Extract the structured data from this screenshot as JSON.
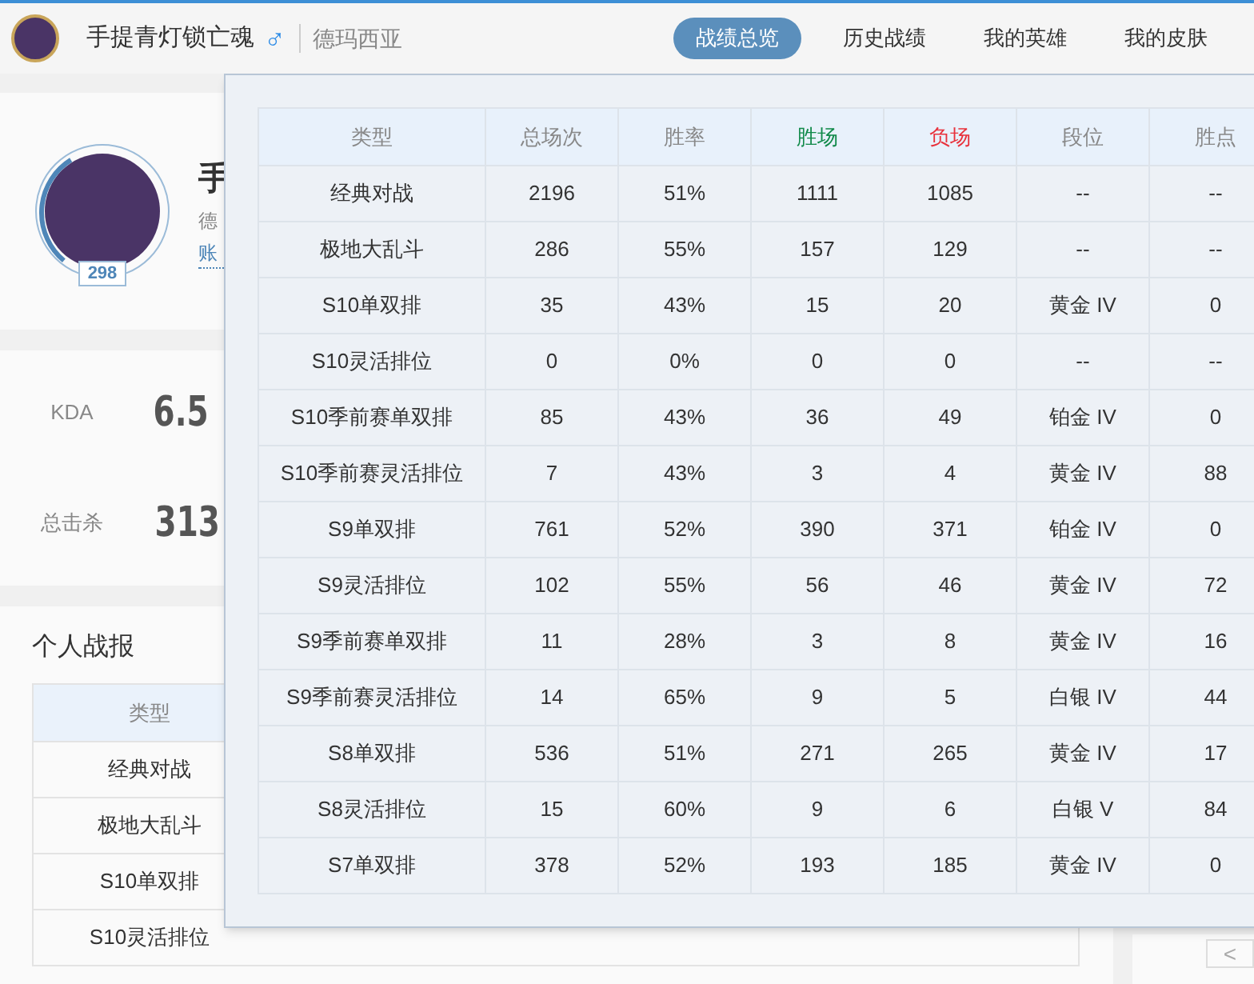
{
  "header": {
    "player_name": "手提青灯锁亡魂",
    "gender_symbol": "♂",
    "server": "德玛西亚",
    "tabs": [
      {
        "label": "战绩总览",
        "selected": true
      },
      {
        "label": "历史战绩",
        "selected": false
      },
      {
        "label": "我的英雄",
        "selected": false
      },
      {
        "label": "我的皮肤",
        "selected": false
      }
    ]
  },
  "profile": {
    "level_text": "298",
    "name_partial": "手",
    "server_partial": "德",
    "account_partial": "账"
  },
  "stats": [
    {
      "label": "KDA",
      "value": "6.5"
    },
    {
      "label": "总击杀",
      "value": "313"
    }
  ],
  "report": {
    "title": "个人战报",
    "header": "类型",
    "rows": [
      "经典对战",
      "极地大乱斗",
      "S10单双排",
      "S10灵活排位"
    ],
    "collapse_glyph": "<"
  },
  "popup": {
    "columns": [
      {
        "label": "类型",
        "color": "#888888"
      },
      {
        "label": "总场次",
        "color": "#888888"
      },
      {
        "label": "胜率",
        "color": "#888888"
      },
      {
        "label": "胜场",
        "color": "#118a4a"
      },
      {
        "label": "负场",
        "color": "#e8323c"
      },
      {
        "label": "段位",
        "color": "#888888"
      },
      {
        "label": "胜点",
        "color": "#888888"
      }
    ],
    "rows": [
      [
        "经典对战",
        "2196",
        "51%",
        "1111",
        "1085",
        "--",
        "--"
      ],
      [
        "极地大乱斗",
        "286",
        "55%",
        "157",
        "129",
        "--",
        "--"
      ],
      [
        "S10单双排",
        "35",
        "43%",
        "15",
        "20",
        "黄金 IV",
        "0"
      ],
      [
        "S10灵活排位",
        "0",
        "0%",
        "0",
        "0",
        "--",
        "--"
      ],
      [
        "S10季前赛单双排",
        "85",
        "43%",
        "36",
        "49",
        "铂金 IV",
        "0"
      ],
      [
        "S10季前赛灵活排位",
        "7",
        "43%",
        "3",
        "4",
        "黄金 IV",
        "88"
      ],
      [
        "S9单双排",
        "761",
        "52%",
        "390",
        "371",
        "铂金 IV",
        "0"
      ],
      [
        "S9灵活排位",
        "102",
        "55%",
        "56",
        "46",
        "黄金 IV",
        "72"
      ],
      [
        "S9季前赛单双排",
        "11",
        "28%",
        "3",
        "8",
        "黄金 IV",
        "16"
      ],
      [
        "S9季前赛灵活排位",
        "14",
        "65%",
        "9",
        "5",
        "白银 IV",
        "44"
      ],
      [
        "S8单双排",
        "536",
        "51%",
        "271",
        "265",
        "黄金 IV",
        "17"
      ],
      [
        "S8灵活排位",
        "15",
        "60%",
        "9",
        "6",
        "白银 V",
        "84"
      ],
      [
        "S7单双排",
        "378",
        "52%",
        "193",
        "185",
        "黄金 IV",
        "0"
      ]
    ]
  }
}
